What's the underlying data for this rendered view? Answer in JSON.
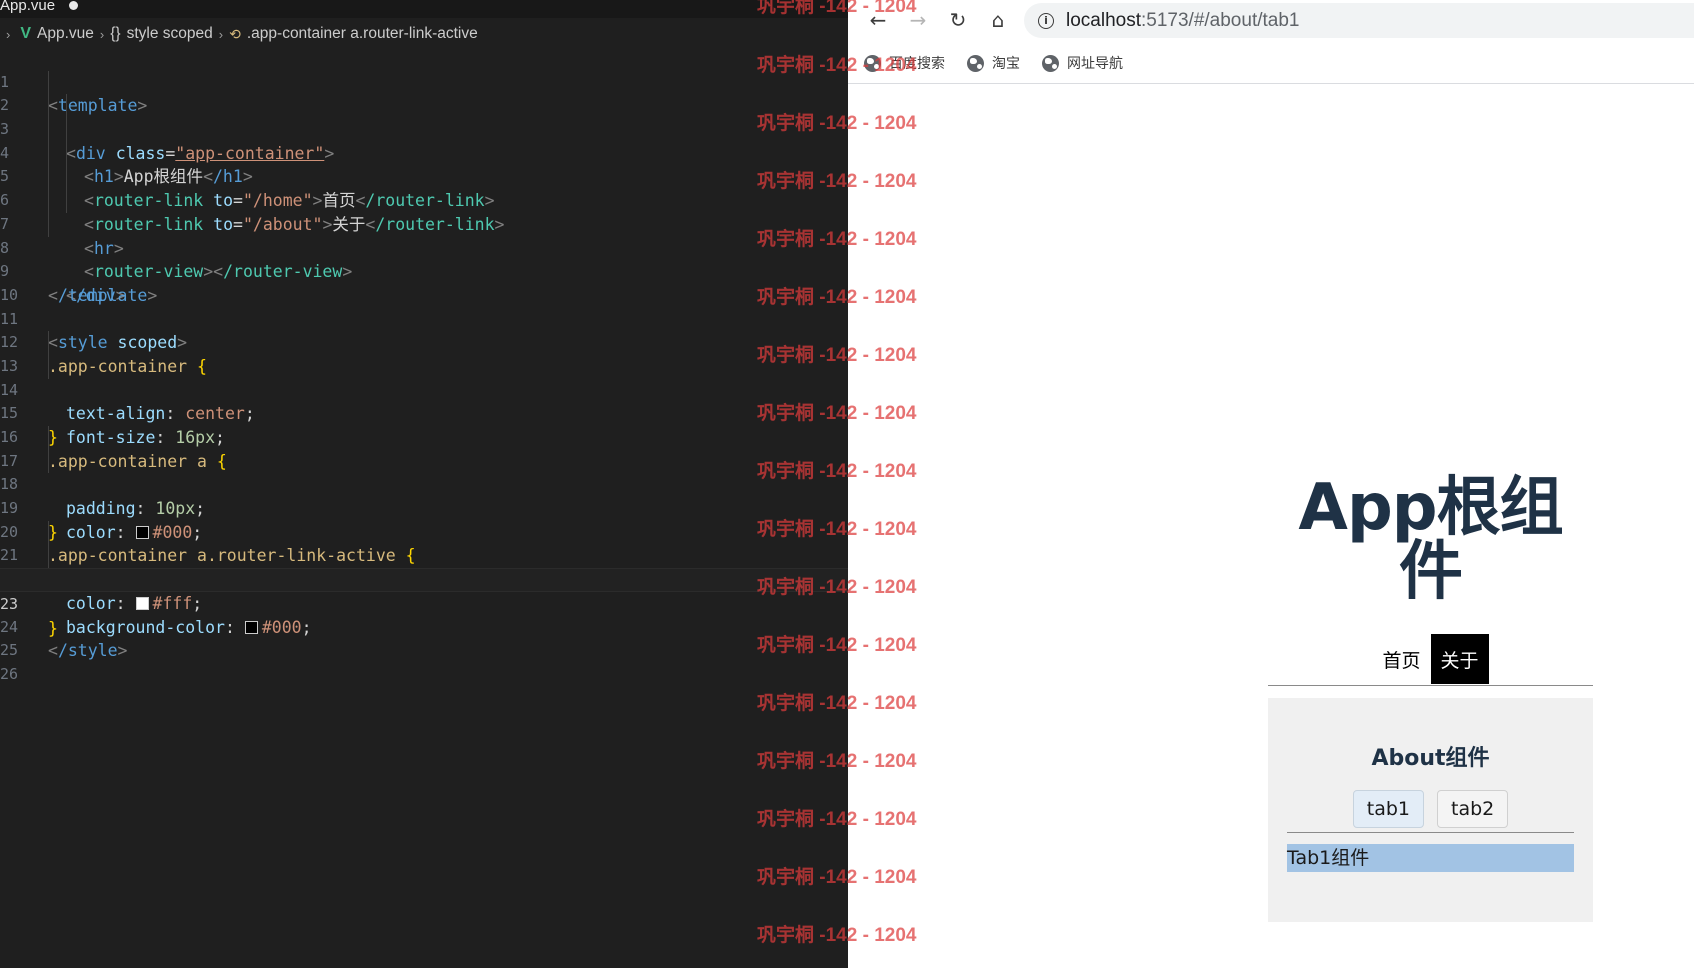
{
  "editor": {
    "tab_label": "App.vue",
    "breadcrumb": [
      "App.vue",
      "style scoped",
      ".app-container a.router-link-active"
    ],
    "line_numbers": [
      "1",
      "2",
      "3",
      "4",
      "5",
      "6",
      "7",
      "8",
      "9",
      "10",
      "11",
      "12",
      "13",
      "14",
      "15",
      "16",
      "17",
      "18",
      "19",
      "20",
      "21",
      "22",
      "23",
      "24",
      "25",
      "26"
    ],
    "code": {
      "l1_tag": "template",
      "l2_tag": "div",
      "l2_attr": "class",
      "l2_val": "\"app-container\"",
      "l3_tag": "h1",
      "l3_text": "App根组件",
      "l3_close": "/h1",
      "l4_tag": "router-link",
      "l4_attr": "to",
      "l4_val": "\"/home\"",
      "l4_text": "首页",
      "l4_close": "/router-link",
      "l5_tag": "router-link",
      "l5_attr": "to",
      "l5_val": "\"/about\"",
      "l5_text": "关于",
      "l5_close": "/router-link",
      "l6_tag": "hr",
      "l7_tag": "router-view",
      "l7_close": "/router-view",
      "l8_close": "/div",
      "l9_close": "/template",
      "l11_tag": "style",
      "l11_attr": "scoped",
      "l12_sel": ".app-container",
      "l13_prop": "text-align",
      "l13_val": "center",
      "l14_prop": "font-size",
      "l14_num": "16px",
      "l16_sel": ".app-container a",
      "l17_prop": "padding",
      "l17_num": "10px",
      "l18_prop": "color",
      "l18_val": "#000",
      "l20_sel": ".app-container a.router-link-active",
      "l21_prop": "color",
      "l21_val": "#fff",
      "l22_prop": "background-color",
      "l22_val": "#000",
      "l24_close": "/style"
    }
  },
  "watermark": {
    "text": "巩宇桐 -142 - 1204"
  },
  "browser": {
    "url_host": "localhost",
    "url_path": ":5173/#/about/tab1",
    "bookmarks": [
      "百度搜索",
      "淘宝",
      "网址导航"
    ]
  },
  "page": {
    "title": "App根组件",
    "links": [
      "首页",
      "关于"
    ],
    "about_title": "About组件",
    "tabs": [
      "tab1",
      "tab2"
    ],
    "tab1_content": "Tab1组件"
  },
  "colors": {
    "editor_bg": "#1f1f1f",
    "heading": "#1f3246",
    "active_link_bg": "#000000",
    "active_link_text": "#ffffff",
    "tab1_highlight": "#a2c3e4",
    "watermark": "#dc3c3c"
  }
}
